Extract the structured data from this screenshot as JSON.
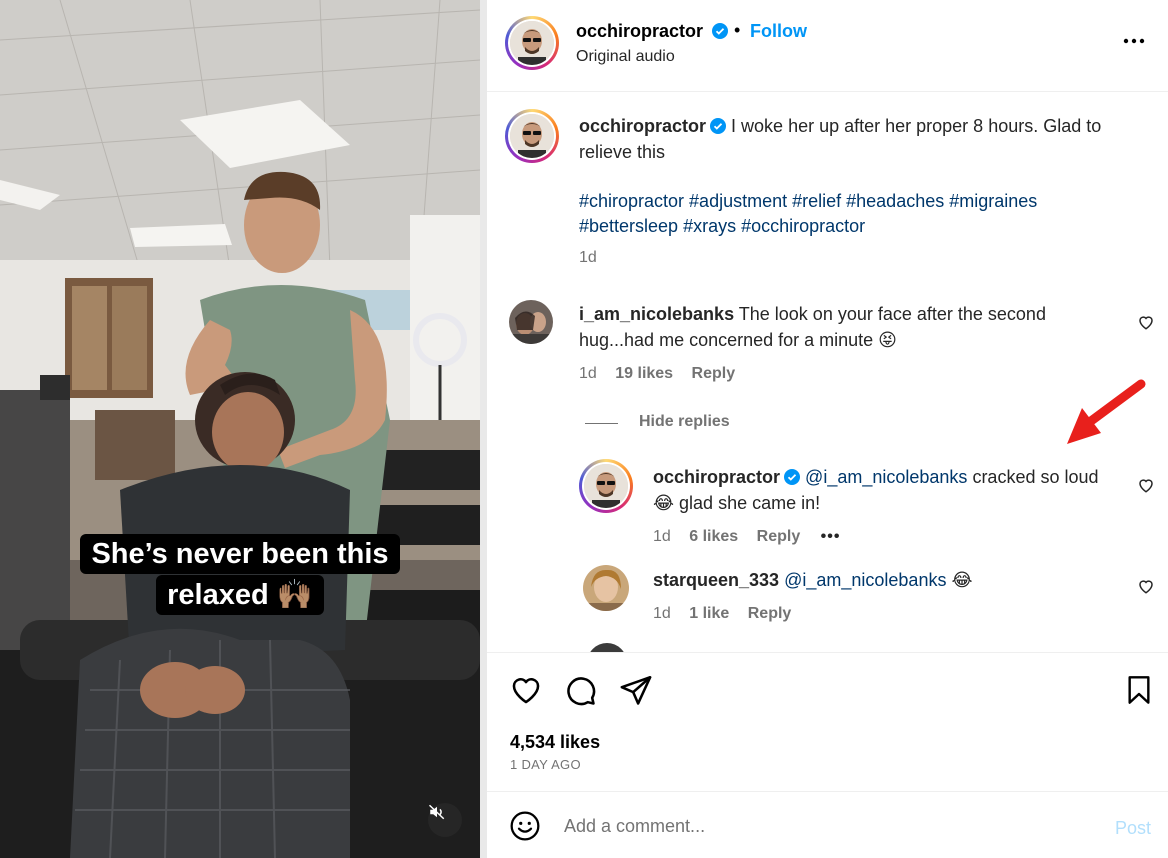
{
  "media": {
    "caption_line1": "She’s never been this",
    "caption_line2": "relaxed 🙌🏽",
    "mute_icon": "speaker-muted-icon"
  },
  "header": {
    "username": "occhiropractor",
    "separator": "•",
    "follow_label": "Follow",
    "audio_label": "Original audio",
    "more_icon": "more-horizontal-icon"
  },
  "post_caption": {
    "username": "occhiropractor",
    "text_line1": "I woke her up after her proper 8 hours. Glad to",
    "text_line2": "relieve this",
    "hashtags_line1": "#chiropractor #adjustment #relief #headaches #migraines",
    "hashtags_line2": "#bettersleep #xrays #occhiropractor",
    "time": "1d"
  },
  "comments": [
    {
      "username": "i_am_nicolebanks",
      "text_line1": "The look on your face after the second",
      "text_line2": "hug...had me concerned for a minute 😝",
      "time": "1d",
      "likes": "19 likes",
      "reply_label": "Reply"
    }
  ],
  "hide_replies_label": "Hide replies",
  "replies": [
    {
      "username": "occhiropractor",
      "mention": "@i_am_nicolebanks",
      "text_line1": "cracked so loud",
      "text_line2": "😂 glad she came in!",
      "time": "1d",
      "likes": "6 likes",
      "reply_label": "Reply",
      "more_label": "•••"
    },
    {
      "username": "starqueen_333",
      "mention": "@i_am_nicolebanks",
      "text": "😂",
      "time": "1d",
      "likes": "1 like",
      "reply_label": "Reply"
    }
  ],
  "footer": {
    "likes": "4,534 likes",
    "posted_ago": "1 DAY AGO",
    "comment_placeholder": "Add a comment...",
    "post_label": "Post"
  },
  "colors": {
    "accent_blue": "#0095f6",
    "hashtag_blue": "#00376b",
    "annotation_arrow": "#e8201c"
  }
}
